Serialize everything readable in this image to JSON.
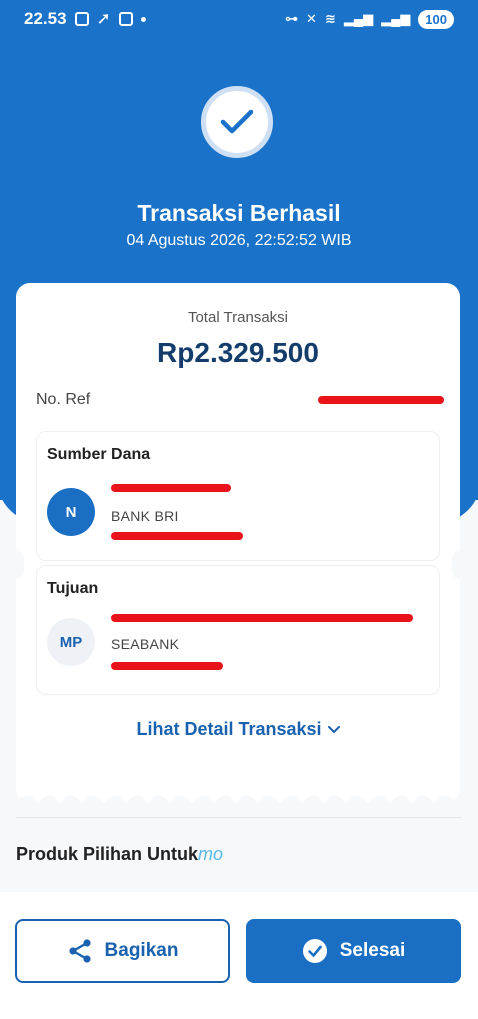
{
  "status_bar": {
    "time": "22.53",
    "battery": "100"
  },
  "header": {
    "title": "Transaksi Berhasil",
    "datetime": "04 Agustus 2026, 22:52:52 WIB"
  },
  "receipt": {
    "total_label": "Total Transaksi",
    "total_amount": "Rp2.329.500",
    "ref_label": "No. Ref",
    "source": {
      "title": "Sumber Dana",
      "avatar_initials": "N",
      "bank": "BANK BRI"
    },
    "destination": {
      "title": "Tujuan",
      "avatar_initials": "MP",
      "bank": "SEABANK"
    },
    "detail_link": "Lihat Detail Transaksi"
  },
  "promo": {
    "title": "Produk Pilihan Untuk",
    "brand": "mo"
  },
  "actions": {
    "share_label": "Bagikan",
    "done_label": "Selesai"
  },
  "colors": {
    "primary": "#1a73c9",
    "amount": "#143d6b",
    "redaction": "#e8131b"
  },
  "icons": {
    "share": "share-icon",
    "done": "check-circle-icon",
    "success": "checkmark-icon"
  }
}
